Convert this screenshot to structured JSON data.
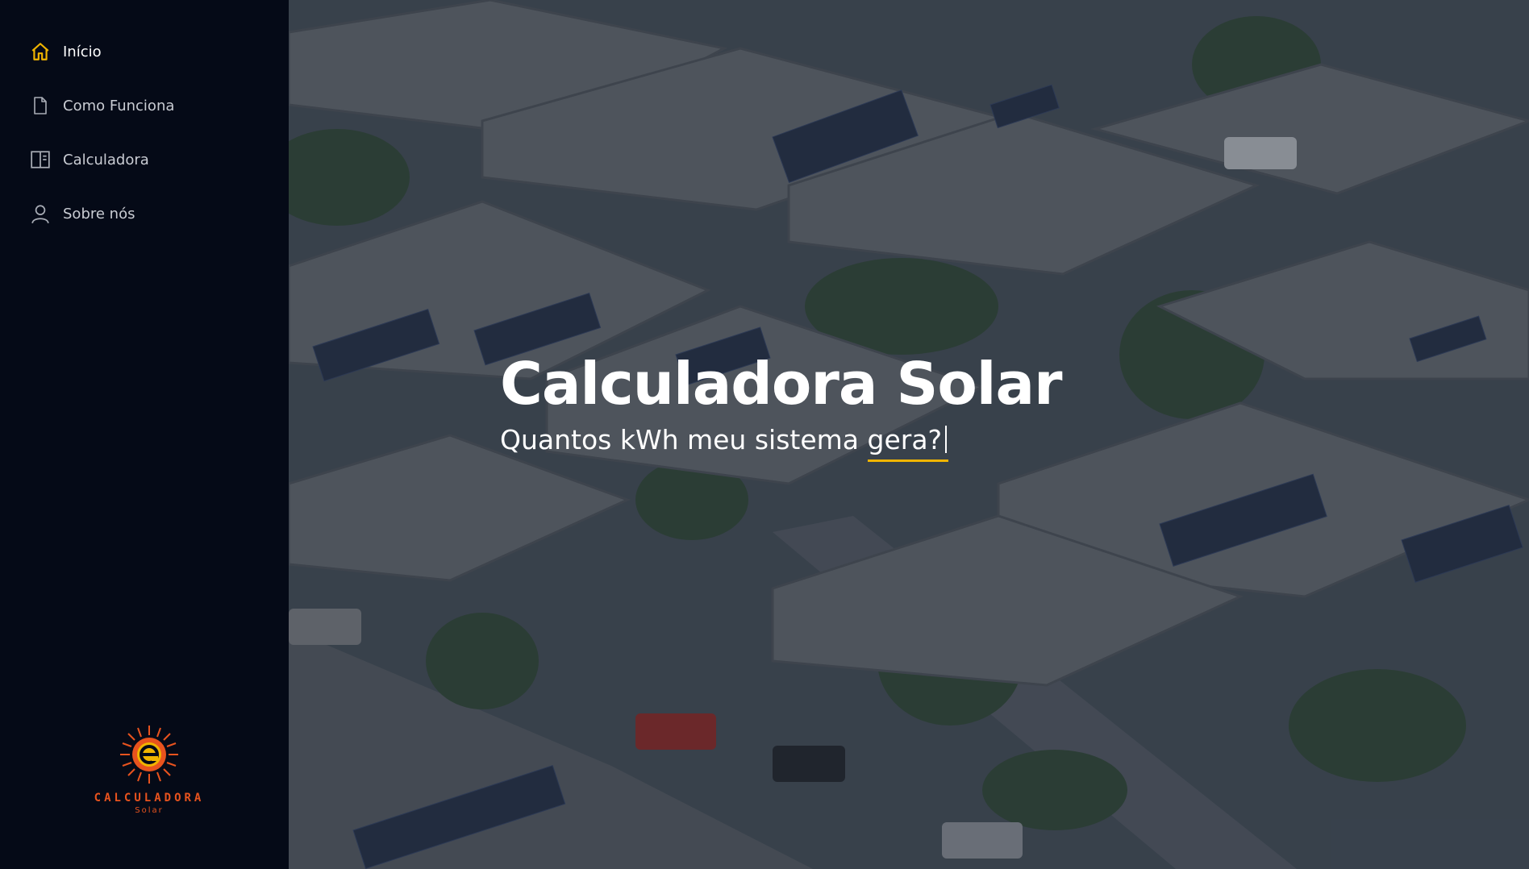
{
  "sidebar": {
    "items": [
      {
        "label": "Início",
        "icon": "home-icon",
        "active": true
      },
      {
        "label": "Como Funciona",
        "icon": "document-icon",
        "active": false
      },
      {
        "label": "Calculadora",
        "icon": "calculator-panel-icon",
        "active": false
      },
      {
        "label": "Sobre nós",
        "icon": "user-icon",
        "active": false
      }
    ],
    "logo": {
      "title": "CALCULADORA",
      "subtitle": "Solar",
      "color": "#e8531e"
    }
  },
  "hero": {
    "title": "Calculadora Solar",
    "subtitle_static": "Quantos kWh meu sistema ",
    "subtitle_typed": "gera?",
    "accent_color": "#f0b400"
  }
}
